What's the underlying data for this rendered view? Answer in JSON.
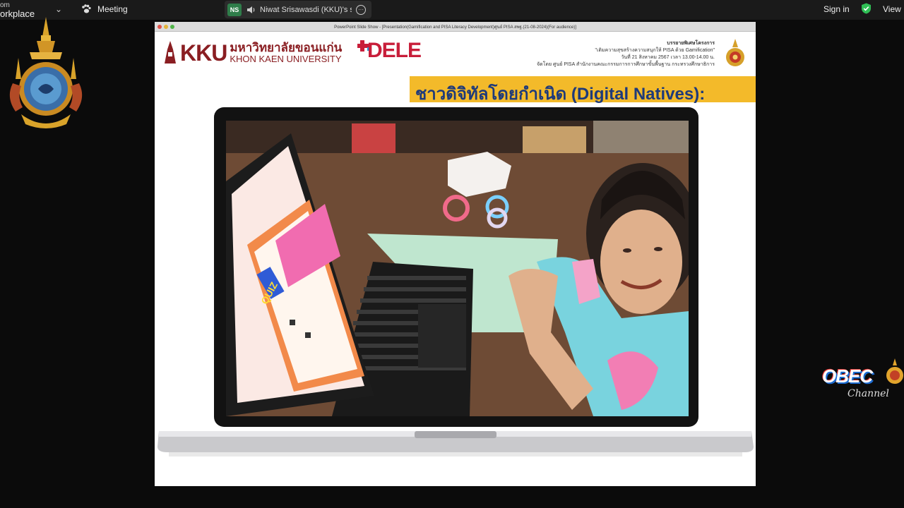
{
  "topbar": {
    "brand": "orkplace",
    "brand_small": "om",
    "meeting_label": "Meeting",
    "sharer_initials": "NS",
    "sharer_name": "Niwat Srisawasdi (KKU)'s scr",
    "signin_label": "Sign in",
    "view_label": "View"
  },
  "slide_window": {
    "title": "PowerPoint Slide Show - [Presentation(Gamification and PISA Literacy Development)ศูนย์ PISA สพฐ.(21-08-2024)(For audience)]"
  },
  "slide": {
    "kku_mark": "KKU",
    "kku_thai": "มหาวิทยาลัยขอนแก่น",
    "kku_english": "KHON KAEN UNIVERSITY",
    "dele_text": "DELE",
    "info_line1": "บรรยายพิเศษโครงการ",
    "info_line2": "\"เติมความสุขสร้างความสนุกให้ PISA ด้วย Gamification\"",
    "info_line3": "วันที่ 21 สิงหาคม 2567 เวลา 13.00-14.00 น.",
    "info_line4": "จัดโดย ศูนย์ PISA สำนักงานคณะกรรมการการศึกษาขั้นพื้นฐาน กระทรวงศึกษาธิการ",
    "banner_title": "ชาวดิจิทัลโดยกำเนิด (Digital Natives):",
    "quiz_label": "QUIZ"
  },
  "overlay": {
    "obec_text": "OBEC",
    "obec_channel": "Channel"
  },
  "colors": {
    "kku_red": "#8a1e22",
    "banner_yellow": "#f3ba2a",
    "banner_text": "#1e3a7a",
    "topbar_bg": "#1a1a1a",
    "shield_green": "#2fbf55"
  },
  "icons": [
    "paw-icon",
    "chevron-down-icon",
    "speaker-icon",
    "more-icon",
    "shield-check-icon",
    "emblem-icon",
    "obec-seal-icon"
  ]
}
